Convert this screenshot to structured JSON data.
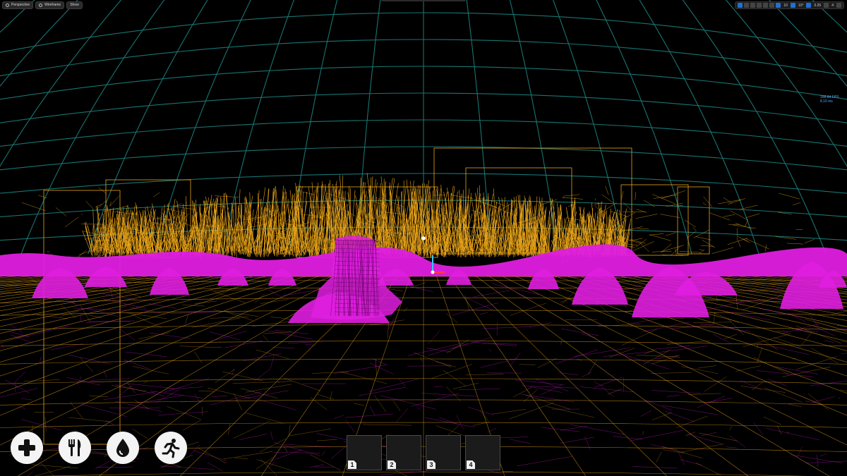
{
  "viewport": {
    "toolbar": {
      "perspective_label": "Perspective",
      "wireframe_label": "Wireframe",
      "show_label": "Show"
    },
    "tool_strip": {
      "grid_value": "10",
      "rotate_value": "10°",
      "scale_value": "0.25",
      "speed_value": "4"
    },
    "stats": {
      "fps": "168.84 FPS",
      "ms": "8.10 ms"
    },
    "colors": {
      "sky_grid": "#1d8a86",
      "foliage_wire": "#e8a317",
      "rock_wire": "#e01ee0",
      "background": "#000000"
    }
  },
  "hud": {
    "buttons": [
      {
        "icon": "health-plus-icon"
      },
      {
        "icon": "food-utensils-icon"
      },
      {
        "icon": "water-drop-icon"
      },
      {
        "icon": "stamina-run-icon"
      }
    ]
  },
  "hotbar": {
    "slots": [
      {
        "number": "1"
      },
      {
        "number": "2"
      },
      {
        "number": "3"
      },
      {
        "number": "4"
      }
    ]
  }
}
